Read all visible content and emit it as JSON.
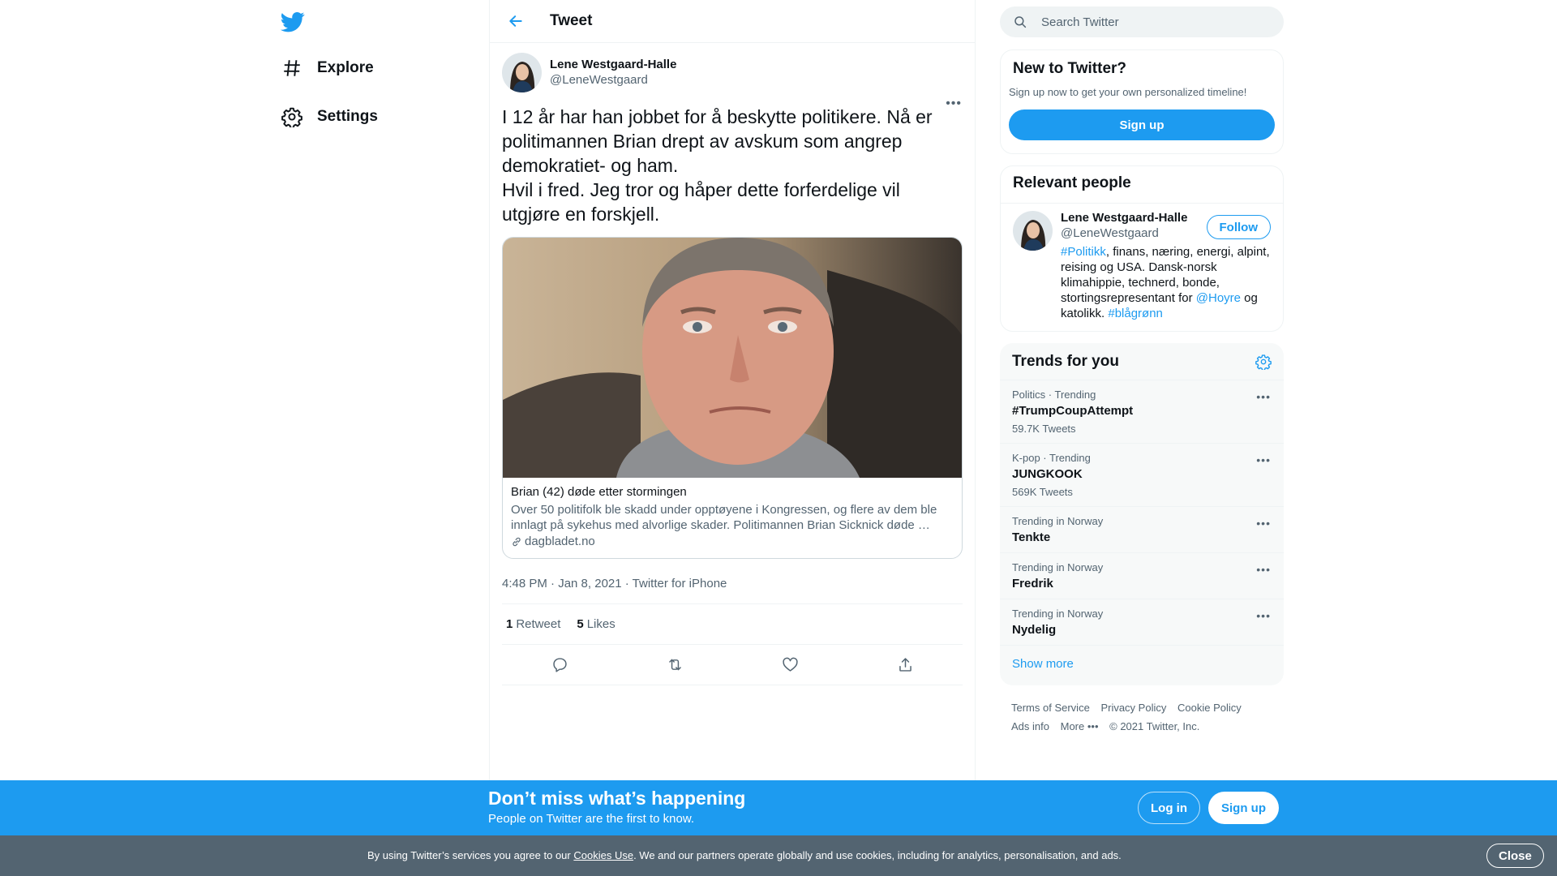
{
  "colors": {
    "accent": "#1d9bf0",
    "text": "#0f1419",
    "muted": "#536471",
    "cookie_bg": "#536471"
  },
  "nav": {
    "logo_icon": "twitter-bird-icon",
    "items": [
      {
        "label": "Explore",
        "icon": "hashtag-icon"
      },
      {
        "label": "Settings",
        "icon": "gear-icon"
      }
    ]
  },
  "header": {
    "title": "Tweet",
    "back_icon": "arrow-left-icon"
  },
  "tweet": {
    "author_name": "Lene Westgaard-Halle",
    "author_handle": "@LeneWestgaard",
    "more_label": "•••",
    "text": "I 12 år har han jobbet for å beskytte politikere. Nå er politimannen Brian drept av avskum som angrep demokratiet- og ham.\nHvil i fred. Jeg tror og håper dette forferdelige vil utgjøre en forskjell.",
    "card": {
      "title": "Brian (42) døde etter stormingen",
      "description": "Over 50 politifolk ble skadd under opptøyene i Kongressen, og flere av dem ble innlagt på sykehus med alvorlige skader. Politimannen Brian Sicknick døde …",
      "domain": "dagbladet.no"
    },
    "timestamp": "4:48 PM · Jan 8, 2021",
    "separator": " · ",
    "source": "Twitter for iPhone",
    "retweets_count": "1",
    "retweets_label": "Retweet",
    "likes_count": "5",
    "likes_label": "Likes"
  },
  "search": {
    "placeholder": "Search Twitter"
  },
  "new_to_twitter": {
    "title": "New to Twitter?",
    "subtitle": "Sign up now to get your own personalized timeline!",
    "signup_label": "Sign up"
  },
  "relevant_people": {
    "title": "Relevant people",
    "name": "Lene Westgaard-Halle",
    "handle": "@LeneWestgaard",
    "follow_label": "Follow",
    "bio": {
      "tag1": "#Politikk",
      "text1": ", finans, næring, energi, alpint, reising og USA. Dansk-norsk klimahippie, technerd, bonde, stortingsrepresentant for ",
      "mention": "@Hoyre",
      "text2": " og katolikk. ",
      "tag2": "#blågrønn"
    }
  },
  "trends": {
    "title": "Trends for you",
    "items": [
      {
        "category": "Politics · Trending",
        "name": "#TrumpCoupAttempt",
        "count": "59.7K Tweets"
      },
      {
        "category": "K-pop · Trending",
        "name": "JUNGKOOK",
        "count": "569K Tweets"
      },
      {
        "category": "Trending in Norway",
        "name": "Tenkte",
        "count": ""
      },
      {
        "category": "Trending in Norway",
        "name": "Fredrik",
        "count": ""
      },
      {
        "category": "Trending in Norway",
        "name": "Nydelig",
        "count": ""
      }
    ],
    "more_label": "•••",
    "show_more": "Show more"
  },
  "footer": {
    "links": [
      "Terms of Service",
      "Privacy Policy",
      "Cookie Policy",
      "Ads info",
      "More •••"
    ],
    "copyright": "© 2021 Twitter, Inc."
  },
  "bottom_banner": {
    "title": "Don’t miss what’s happening",
    "subtitle": "People on Twitter are the first to know.",
    "login_label": "Log in",
    "signup_label": "Sign up"
  },
  "cookie": {
    "text_before": "By using Twitter’s services you agree to our ",
    "link": "Cookies Use",
    "text_after": ". We and our partners operate globally and use cookies, including for analytics, personalisation, and ads.",
    "close_label": "Close"
  }
}
